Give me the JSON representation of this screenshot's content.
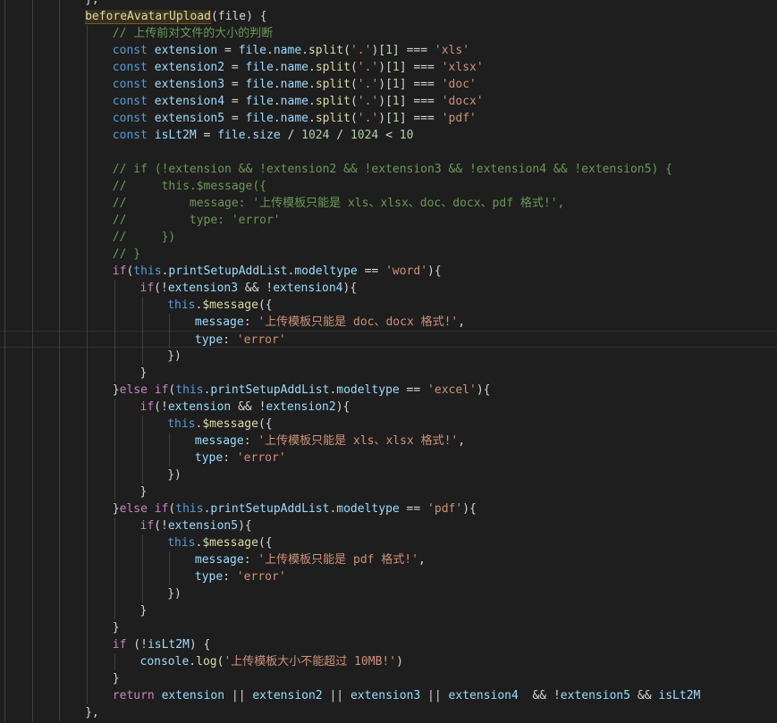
{
  "editor": {
    "theme_colors": {
      "background": "#1e1e1e",
      "keyword": "#569cd6",
      "control": "#c586c0",
      "function": "#dcdcaa",
      "variable": "#9cdcfe",
      "string": "#ce9178",
      "number": "#b5cea8",
      "comment": "#6a9955"
    },
    "lines": [
      {
        "indent": 3,
        "tokens": [
          [
            "pun",
            "},"
          ]
        ]
      },
      {
        "indent": 3,
        "tokens": [
          [
            "fn hl",
            "beforeAvatarUpload"
          ],
          [
            "pun",
            "(file) {"
          ]
        ]
      },
      {
        "indent": 4,
        "tokens": [
          [
            "cmt",
            "// 上传前对文件的大小的判断"
          ]
        ]
      },
      {
        "indent": 4,
        "tokens": [
          [
            "kw",
            "const "
          ],
          [
            "var",
            "extension"
          ],
          [
            "pun",
            " = "
          ],
          [
            "var",
            "file"
          ],
          [
            "pun",
            "."
          ],
          [
            "var",
            "name"
          ],
          [
            "pun",
            "."
          ],
          [
            "fn",
            "split"
          ],
          [
            "pun",
            "("
          ],
          [
            "str",
            "'.'"
          ],
          [
            "pun",
            ")["
          ],
          [
            "num",
            "1"
          ],
          [
            "pun",
            "] === "
          ],
          [
            "str",
            "'xls'"
          ]
        ]
      },
      {
        "indent": 4,
        "tokens": [
          [
            "kw",
            "const "
          ],
          [
            "var",
            "extension2"
          ],
          [
            "pun",
            " = "
          ],
          [
            "var",
            "file"
          ],
          [
            "pun",
            "."
          ],
          [
            "var",
            "name"
          ],
          [
            "pun",
            "."
          ],
          [
            "fn",
            "split"
          ],
          [
            "pun",
            "("
          ],
          [
            "str",
            "'.'"
          ],
          [
            "pun",
            ")["
          ],
          [
            "num",
            "1"
          ],
          [
            "pun",
            "] === "
          ],
          [
            "str",
            "'xlsx'"
          ]
        ]
      },
      {
        "indent": 4,
        "tokens": [
          [
            "kw",
            "const "
          ],
          [
            "var",
            "extension3"
          ],
          [
            "pun",
            " = "
          ],
          [
            "var",
            "file"
          ],
          [
            "pun",
            "."
          ],
          [
            "var",
            "name"
          ],
          [
            "pun",
            "."
          ],
          [
            "fn",
            "split"
          ],
          [
            "pun",
            "("
          ],
          [
            "str",
            "'.'"
          ],
          [
            "pun",
            ")["
          ],
          [
            "num",
            "1"
          ],
          [
            "pun",
            "] === "
          ],
          [
            "str",
            "'doc'"
          ]
        ]
      },
      {
        "indent": 4,
        "tokens": [
          [
            "kw",
            "const "
          ],
          [
            "var",
            "extension4"
          ],
          [
            "pun",
            " = "
          ],
          [
            "var",
            "file"
          ],
          [
            "pun",
            "."
          ],
          [
            "var",
            "name"
          ],
          [
            "pun",
            "."
          ],
          [
            "fn",
            "split"
          ],
          [
            "pun",
            "("
          ],
          [
            "str",
            "'.'"
          ],
          [
            "pun",
            ")["
          ],
          [
            "num",
            "1"
          ],
          [
            "pun",
            "] === "
          ],
          [
            "str",
            "'docx'"
          ]
        ]
      },
      {
        "indent": 4,
        "tokens": [
          [
            "kw",
            "const "
          ],
          [
            "var",
            "extension5"
          ],
          [
            "pun",
            " = "
          ],
          [
            "var",
            "file"
          ],
          [
            "pun",
            "."
          ],
          [
            "var",
            "name"
          ],
          [
            "pun",
            "."
          ],
          [
            "fn",
            "split"
          ],
          [
            "pun",
            "("
          ],
          [
            "str",
            "'.'"
          ],
          [
            "pun",
            ")["
          ],
          [
            "num",
            "1"
          ],
          [
            "pun",
            "] === "
          ],
          [
            "str",
            "'pdf'"
          ]
        ]
      },
      {
        "indent": 4,
        "tokens": [
          [
            "kw",
            "const "
          ],
          [
            "var",
            "isLt2M"
          ],
          [
            "pun",
            " = "
          ],
          [
            "var",
            "file"
          ],
          [
            "pun",
            "."
          ],
          [
            "var",
            "size"
          ],
          [
            "pun",
            " / "
          ],
          [
            "num",
            "1024"
          ],
          [
            "pun",
            " / "
          ],
          [
            "num",
            "1024"
          ],
          [
            "pun",
            " < "
          ],
          [
            "num",
            "10"
          ]
        ]
      },
      {
        "indent": 4,
        "tokens": []
      },
      {
        "indent": 4,
        "tokens": [
          [
            "cmt",
            "// if (!extension && !extension2 && !extension3 && !extension4 && !extension5) {"
          ]
        ]
      },
      {
        "indent": 4,
        "tokens": [
          [
            "cmt",
            "//     this.$message({"
          ]
        ]
      },
      {
        "indent": 4,
        "tokens": [
          [
            "cmt",
            "//         message: '上传模板只能是 xls、xlsx、doc、docx、pdf 格式!',"
          ]
        ]
      },
      {
        "indent": 4,
        "tokens": [
          [
            "cmt",
            "//         type: 'error'"
          ]
        ]
      },
      {
        "indent": 4,
        "tokens": [
          [
            "cmt",
            "//     })"
          ]
        ]
      },
      {
        "indent": 4,
        "tokens": [
          [
            "cmt",
            "// }"
          ]
        ]
      },
      {
        "indent": 4,
        "tokens": [
          [
            "ctl",
            "if"
          ],
          [
            "pun",
            "("
          ],
          [
            "kw",
            "this"
          ],
          [
            "pun",
            "."
          ],
          [
            "var",
            "printSetupAddList"
          ],
          [
            "pun",
            "."
          ],
          [
            "var",
            "modeltype"
          ],
          [
            "pun",
            " == "
          ],
          [
            "str",
            "'word'"
          ],
          [
            "pun",
            "){"
          ]
        ]
      },
      {
        "indent": 5,
        "tokens": [
          [
            "ctl",
            "if"
          ],
          [
            "pun",
            "(!"
          ],
          [
            "var",
            "extension3"
          ],
          [
            "pun",
            " && !"
          ],
          [
            "var",
            "extension4"
          ],
          [
            "pun",
            "){"
          ]
        ]
      },
      {
        "indent": 6,
        "tokens": [
          [
            "kw",
            "this"
          ],
          [
            "pun",
            "."
          ],
          [
            "fn",
            "$message"
          ],
          [
            "pun",
            "({"
          ]
        ]
      },
      {
        "indent": 7,
        "tokens": [
          [
            "var",
            "message"
          ],
          [
            "pun",
            ": "
          ],
          [
            "str",
            "'上传模板只能是 doc、docx 格式!'"
          ],
          [
            "pun",
            ","
          ]
        ]
      },
      {
        "indent": 7,
        "tokens": [
          [
            "var",
            "type"
          ],
          [
            "pun",
            ": "
          ],
          [
            "str",
            "'error'"
          ]
        ],
        "current": true
      },
      {
        "indent": 6,
        "tokens": [
          [
            "pun",
            "})"
          ]
        ]
      },
      {
        "indent": 5,
        "tokens": [
          [
            "pun",
            "}"
          ]
        ]
      },
      {
        "indent": 4,
        "tokens": [
          [
            "pun",
            "}"
          ],
          [
            "ctl",
            "else if"
          ],
          [
            "pun",
            "("
          ],
          [
            "kw",
            "this"
          ],
          [
            "pun",
            "."
          ],
          [
            "var",
            "printSetupAddList"
          ],
          [
            "pun",
            "."
          ],
          [
            "var",
            "modeltype"
          ],
          [
            "pun",
            " == "
          ],
          [
            "str",
            "'excel'"
          ],
          [
            "pun",
            "){"
          ]
        ]
      },
      {
        "indent": 5,
        "tokens": [
          [
            "ctl",
            "if"
          ],
          [
            "pun",
            "(!"
          ],
          [
            "var",
            "extension"
          ],
          [
            "pun",
            " && !"
          ],
          [
            "var",
            "extension2"
          ],
          [
            "pun",
            "){"
          ]
        ]
      },
      {
        "indent": 6,
        "tokens": [
          [
            "kw",
            "this"
          ],
          [
            "pun",
            "."
          ],
          [
            "fn",
            "$message"
          ],
          [
            "pun",
            "({"
          ]
        ]
      },
      {
        "indent": 7,
        "tokens": [
          [
            "var",
            "message"
          ],
          [
            "pun",
            ": "
          ],
          [
            "str",
            "'上传模板只能是 xls、xlsx 格式!'"
          ],
          [
            "pun",
            ","
          ]
        ]
      },
      {
        "indent": 7,
        "tokens": [
          [
            "var",
            "type"
          ],
          [
            "pun",
            ": "
          ],
          [
            "str",
            "'error'"
          ]
        ]
      },
      {
        "indent": 6,
        "tokens": [
          [
            "pun",
            "})"
          ]
        ]
      },
      {
        "indent": 5,
        "tokens": [
          [
            "pun",
            "}"
          ]
        ]
      },
      {
        "indent": 4,
        "tokens": [
          [
            "pun",
            "}"
          ],
          [
            "ctl",
            "else if"
          ],
          [
            "pun",
            "("
          ],
          [
            "kw",
            "this"
          ],
          [
            "pun",
            "."
          ],
          [
            "var",
            "printSetupAddList"
          ],
          [
            "pun",
            "."
          ],
          [
            "var",
            "modeltype"
          ],
          [
            "pun",
            " == "
          ],
          [
            "str",
            "'pdf'"
          ],
          [
            "pun",
            "){"
          ]
        ]
      },
      {
        "indent": 5,
        "tokens": [
          [
            "ctl",
            "if"
          ],
          [
            "pun",
            "(!"
          ],
          [
            "var",
            "extension5"
          ],
          [
            "pun",
            "){"
          ]
        ]
      },
      {
        "indent": 6,
        "tokens": [
          [
            "kw",
            "this"
          ],
          [
            "pun",
            "."
          ],
          [
            "fn",
            "$message"
          ],
          [
            "pun",
            "({"
          ]
        ]
      },
      {
        "indent": 7,
        "tokens": [
          [
            "var",
            "message"
          ],
          [
            "pun",
            ": "
          ],
          [
            "str",
            "'上传模板只能是 pdf 格式!'"
          ],
          [
            "pun",
            ","
          ]
        ]
      },
      {
        "indent": 7,
        "tokens": [
          [
            "var",
            "type"
          ],
          [
            "pun",
            ": "
          ],
          [
            "str",
            "'error'"
          ]
        ]
      },
      {
        "indent": 6,
        "tokens": [
          [
            "pun",
            "})"
          ]
        ]
      },
      {
        "indent": 5,
        "tokens": [
          [
            "pun",
            "}"
          ]
        ]
      },
      {
        "indent": 4,
        "tokens": [
          [
            "pun",
            "}"
          ]
        ]
      },
      {
        "indent": 4,
        "tokens": [
          [
            "ctl",
            "if"
          ],
          [
            "pun",
            " (!"
          ],
          [
            "var",
            "isLt2M"
          ],
          [
            "pun",
            ") {"
          ]
        ]
      },
      {
        "indent": 5,
        "tokens": [
          [
            "var",
            "console"
          ],
          [
            "pun",
            "."
          ],
          [
            "fn",
            "log"
          ],
          [
            "pun",
            "("
          ],
          [
            "str",
            "'上传模板大小不能超过 10MB!'"
          ],
          [
            "pun",
            ")"
          ]
        ]
      },
      {
        "indent": 4,
        "tokens": [
          [
            "pun",
            "}"
          ]
        ]
      },
      {
        "indent": 4,
        "tokens": [
          [
            "ctl",
            "return "
          ],
          [
            "var",
            "extension"
          ],
          [
            "pun",
            " || "
          ],
          [
            "var",
            "extension2"
          ],
          [
            "pun",
            " || "
          ],
          [
            "var",
            "extension3"
          ],
          [
            "pun",
            " || "
          ],
          [
            "var",
            "extension4"
          ],
          [
            "pun",
            "  && !"
          ],
          [
            "var",
            "extension5"
          ],
          [
            "pun",
            " && "
          ],
          [
            "var",
            "isLt2M"
          ]
        ]
      },
      {
        "indent": 3,
        "tokens": [
          [
            "pun",
            "},"
          ]
        ]
      }
    ]
  }
}
